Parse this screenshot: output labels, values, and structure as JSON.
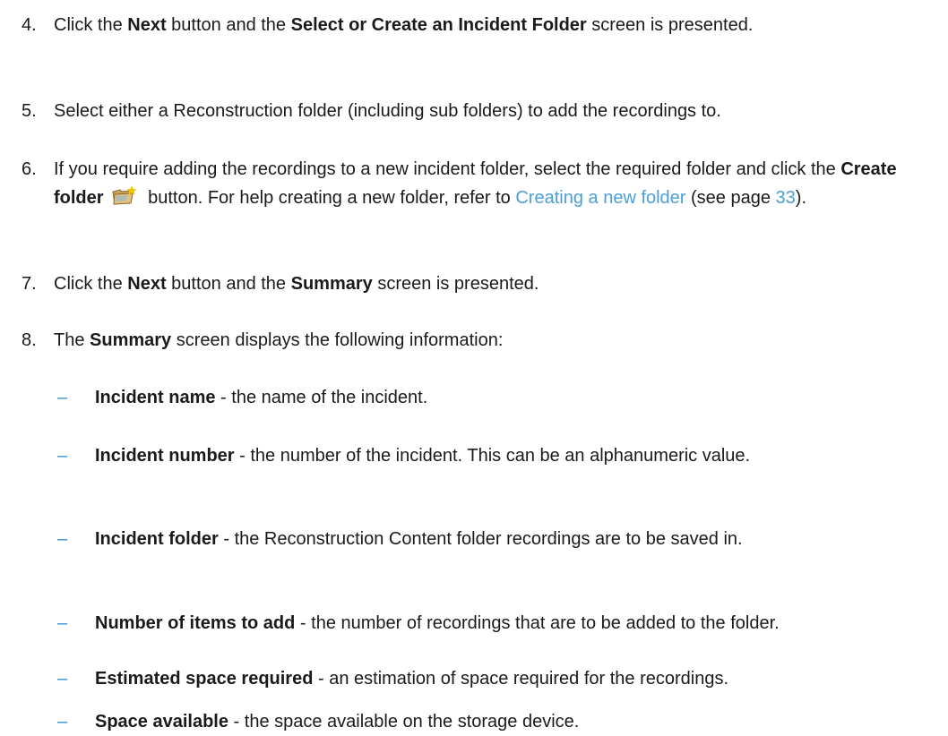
{
  "steps": [
    {
      "number": "4.",
      "t1": "Click the ",
      "b1": "Next",
      "t2": " button and the ",
      "b2": "Select or Create an Incident Folder",
      "t3": " screen is presented."
    },
    {
      "number": "5.",
      "t1": "Select either a Reconstruction folder (including sub folders) to add the recordings to."
    },
    {
      "number": "6.",
      "t1": "If you require adding the recordings to a new incident folder, select the required folder and click the ",
      "b1": "Create folder",
      "icon": "create-folder-icon",
      "t2": " button. For help creating a new folder, refer to ",
      "link": "Creating a new folder",
      "t3": " (see page ",
      "page_ref": "33",
      "t4": ")."
    },
    {
      "number": "7.",
      "t1": "Click the ",
      "b1": "Next",
      "t2": " button and the ",
      "b2": "Summary",
      "t3": " screen is presented."
    },
    {
      "number": "8.",
      "t1": "The ",
      "b1": "Summary",
      "t2": " screen displays the following information:"
    }
  ],
  "summary_items": [
    {
      "dash": "–",
      "term": "Incident name",
      "desc": " - the name of the incident."
    },
    {
      "dash": "–",
      "term": "Incident number",
      "desc": " - the number of the incident. This can be an alphanumeric value."
    },
    {
      "dash": "–",
      "term": "Incident folder",
      "desc": " - the Reconstruction Content folder recordings are to be saved in."
    },
    {
      "dash": "–",
      "term": "Number of items to add",
      "desc": " - the number of recordings that are to be added to the folder."
    },
    {
      "dash": "–",
      "term": "Estimated space required",
      "desc": " - an estimation of space required for the recordings."
    },
    {
      "dash": "–",
      "term": "Space available",
      "desc": " - the space available on the storage device."
    }
  ],
  "colors": {
    "link": "#4a9fd8",
    "dash": "#3a8fd0",
    "text": "#1a1a1a"
  }
}
